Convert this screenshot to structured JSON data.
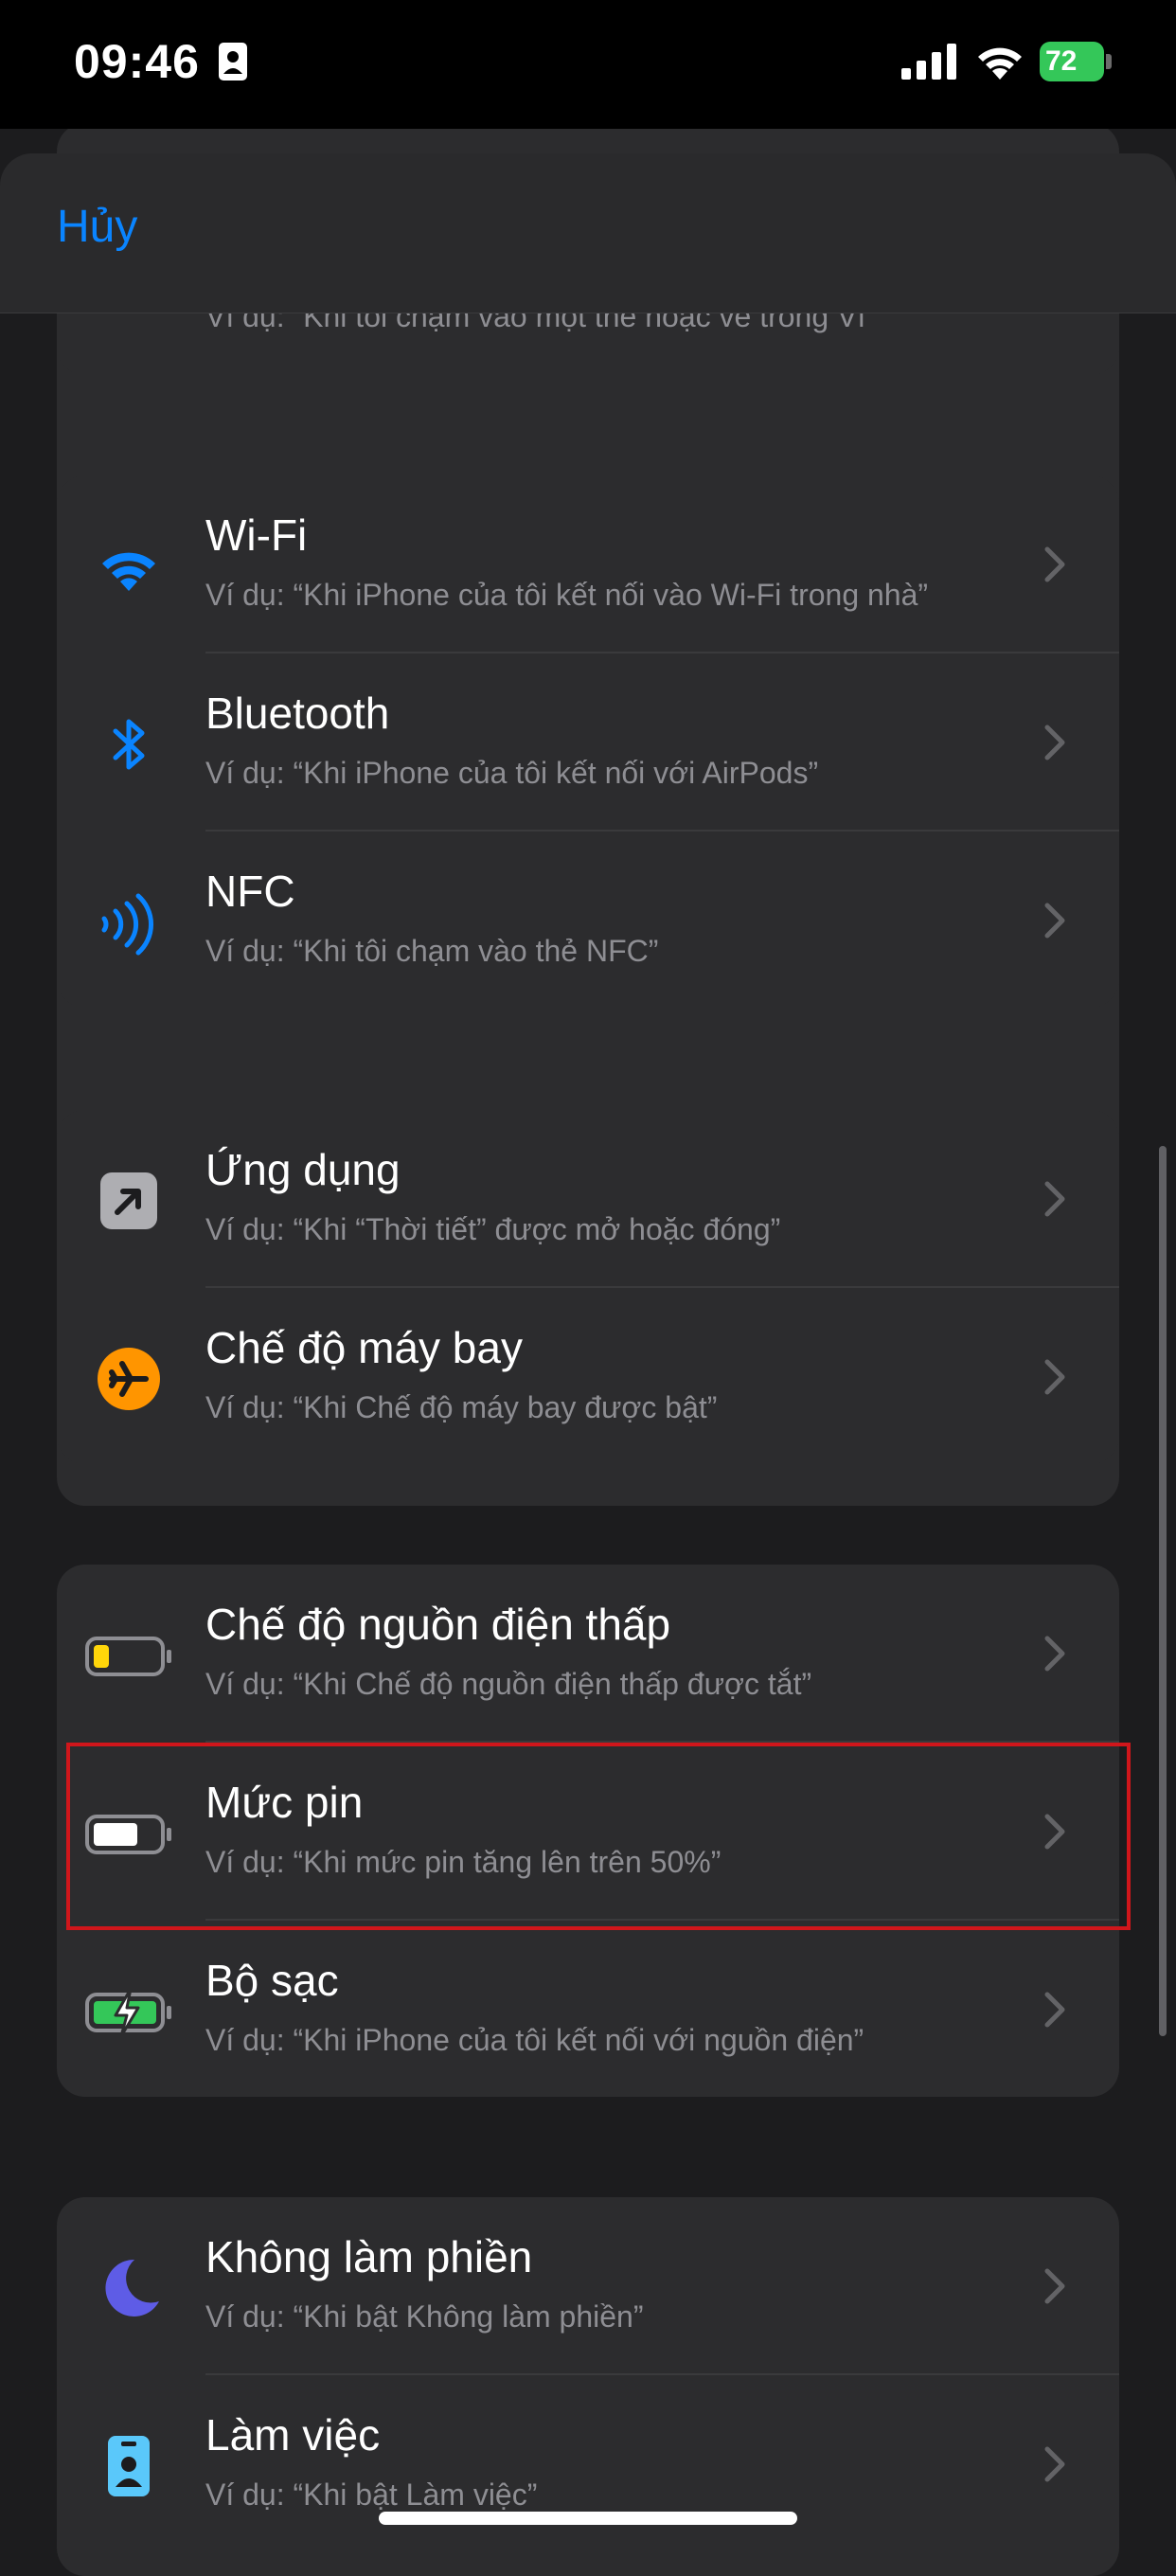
{
  "status_bar": {
    "time": "09:46",
    "battery": "72"
  },
  "header": {
    "cancel_label": "Hủy"
  },
  "top_partial": {
    "subtitle": "Ví dụ: “Khi tôi chạm vào một thẻ hoặc vé trong Ví”"
  },
  "sections": [
    {
      "rows": [
        {
          "icon": "wifi-icon",
          "title": "Wi‑Fi",
          "subtitle": "Ví dụ: “Khi iPhone của tôi kết nối vào Wi‑Fi trong nhà”"
        },
        {
          "icon": "bluetooth-icon",
          "title": "Bluetooth",
          "subtitle": "Ví dụ: “Khi iPhone của tôi kết nối với AirPods”"
        },
        {
          "icon": "nfc-icon",
          "title": "NFC",
          "subtitle": "Ví dụ: “Khi tôi chạm vào thẻ NFC”"
        }
      ]
    },
    {
      "rows": [
        {
          "icon": "app-arrow-icon",
          "title": "Ứng dụng",
          "subtitle": "Ví dụ: “Khi “Thời tiết” được mở hoặc đóng”"
        },
        {
          "icon": "airplane-icon",
          "title": "Chế độ máy bay",
          "subtitle": "Ví dụ: “Khi Chế độ máy bay được bật”"
        }
      ]
    },
    {
      "rows": [
        {
          "icon": "low-power-battery-icon",
          "title": "Chế độ nguồn điện thấp",
          "subtitle": "Ví dụ: “Khi Chế độ nguồn điện thấp được tắt”"
        },
        {
          "icon": "battery-level-icon",
          "title": "Mức pin",
          "subtitle": "Ví dụ: “Khi mức pin tăng lên trên 50%”"
        },
        {
          "icon": "charger-icon",
          "title": "Bộ sạc",
          "subtitle": "Ví dụ: “Khi iPhone của tôi kết nối với nguồn điện”"
        }
      ]
    },
    {
      "rows": [
        {
          "icon": "moon-icon",
          "title": "Không làm phiền",
          "subtitle": "Ví dụ: “Khi bật Không làm phiền”"
        },
        {
          "icon": "work-badge-icon",
          "title": "Làm việc",
          "subtitle": "Ví dụ: “Khi bật Làm việc”"
        }
      ]
    }
  ],
  "colors": {
    "accent": "#0a84ff",
    "highlight": "#d0161b",
    "orange": "#ff9500",
    "green": "#34c759",
    "purple": "#5e5ce6",
    "teal": "#5ac8fa"
  }
}
